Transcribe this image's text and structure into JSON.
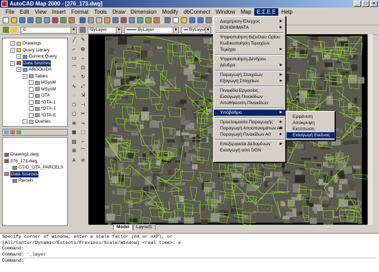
{
  "window": {
    "title": "AutoCAD Map 2000 - [376_173.dwg]"
  },
  "menubar": {
    "items": [
      "File",
      "Edit",
      "View",
      "Insert",
      "Format",
      "Tools",
      "Draw",
      "Dimension",
      "Modify",
      "dbConnect",
      "Window",
      "Map",
      "Ε.Σ.Ε.Ε",
      "Help"
    ],
    "active_index": 12
  },
  "toolbar": {
    "layer_combo": "0",
    "color_combo": "ByLayer",
    "linetype_combo": "ByLayer",
    "lineweight_combo": "ByLayer"
  },
  "workspace_tree": {
    "items": [
      {
        "label": "Drawings",
        "depth": 1
      },
      {
        "label": "Query Library",
        "depth": 1
      },
      {
        "label": "Current Query",
        "depth": 2
      },
      {
        "label": "Data Sources",
        "depth": 1,
        "selected": true
      },
      {
        "label": "ARGOLIDA",
        "depth": 2
      },
      {
        "label": "Tables",
        "depth": 3
      },
      {
        "label": "MSysM",
        "depth": 4
      },
      {
        "label": "MSysM",
        "depth": 4
      },
      {
        "label": "OTA",
        "depth": 4
      },
      {
        "label": "*OTA-1",
        "depth": 4
      },
      {
        "label": "*OTA-1",
        "depth": 4
      },
      {
        "label": "*OTA-E",
        "depth": 4
      },
      {
        "label": "Queries",
        "depth": 3
      }
    ]
  },
  "data_tree": {
    "items": [
      {
        "label": "Drawing1.dwg",
        "depth": 0
      },
      {
        "label": "376_173.dwg",
        "depth": 0
      },
      {
        "label": "GTID_OTA_PARCELS",
        "depth": 1
      },
      {
        "label": "Data Sources",
        "depth": 0,
        "selected": true
      },
      {
        "label": "Parcels",
        "depth": 1
      }
    ]
  },
  "layout_tabs": [
    "Model",
    "Layout1"
  ],
  "command_lines": [
    "Specify corner of window, enter a scale factor (nX or nXP), or",
    "[All/Center/Dynamic/Extents/Previous/Scale/Window] <real time>: e",
    "Command:",
    "Command: '_layer",
    "Command:"
  ],
  "menu_esee": {
    "items": [
      {
        "label": "Διαχείριση-Έλεγχος",
        "submenu": true
      },
      {
        "label": "ΒΟΗΘΗΜΑΤΑ",
        "submenu": true
      },
      {
        "sep": true
      },
      {
        "label": "Ψηφιοποίηση Βιζυέλου Ορίου"
      },
      {
        "label": "Κωδικοποίηση Τεμαχίων"
      },
      {
        "label": "Τεμάχια",
        "submenu": true
      },
      {
        "sep": true
      },
      {
        "label": "Ψηφιοποίηση Δένδρου"
      },
      {
        "label": "Δένδρα",
        "submenu": true
      },
      {
        "sep": true
      },
      {
        "label": "Παραγωγή Στοιχείων",
        "submenu": true
      },
      {
        "label": "Εξαγωγή Στοιχείων",
        "submenu": true
      },
      {
        "sep": true
      },
      {
        "label": "Πινακίδα Εργασίας"
      },
      {
        "label": "Εισαγωγή Πινακίδων"
      },
      {
        "label": "Αποθήκευση Πινακίδων"
      },
      {
        "sep": true
      },
      {
        "label": "Υπόβαθρο",
        "submenu": true,
        "highlighted": true
      },
      {
        "sep": true
      },
      {
        "label": "Προετοιμασία Παραγωγής",
        "submenu": true
      },
      {
        "label": "Παραγωγή Αποσπασμάτων Α4",
        "submenu": true
      },
      {
        "label": "Παραγωγή Πινακίδων Α0",
        "submenu": true
      },
      {
        "sep": true
      },
      {
        "label": "Επεξεργασία Δεδομένων",
        "submenu": true
      },
      {
        "label": "Εισαγωγή απο DGN"
      }
    ]
  },
  "submenu_ypovathro": {
    "items": [
      {
        "label": "Εμφάνιση"
      },
      {
        "label": "Απόκρυψη"
      },
      {
        "label": "Εκτύπωση"
      },
      {
        "label": "Εισαγωγή Εικόνας",
        "highlighted": true
      }
    ]
  },
  "icons": {
    "app": "autocad-app-icon",
    "minimize": "minimize-icon",
    "maximize": "maximize-icon",
    "close": "close-icon"
  }
}
